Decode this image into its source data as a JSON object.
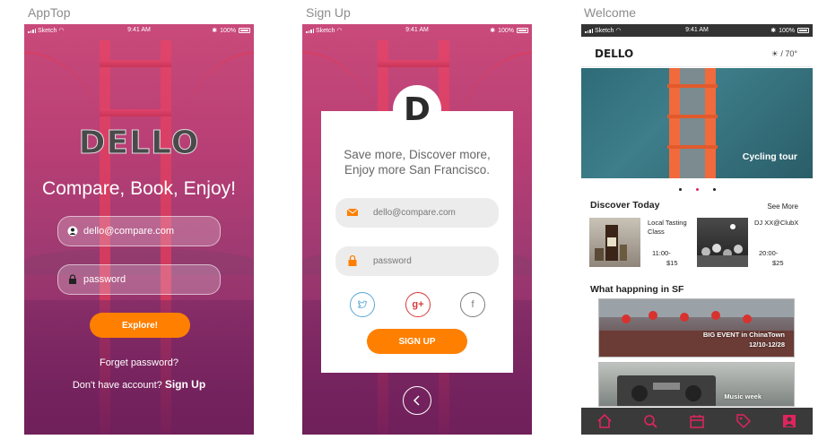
{
  "artboards": [
    {
      "title": "AppTop"
    },
    {
      "title": "Sign Up"
    },
    {
      "title": "Welcome"
    }
  ],
  "statusbar": {
    "carrier": "Sketch",
    "time": "9:41 AM",
    "battery": "100%"
  },
  "screen1": {
    "logo": "DELLO",
    "tagline": "Compare, Book, Enjoy!",
    "email_placeholder": "dello@compare.com",
    "password_placeholder": "password",
    "explore_button": "Explore!",
    "forget_password": "Forget password?",
    "no_account": "Don't have account?",
    "signup_link": "Sign Up"
  },
  "screen2": {
    "logo_letter": "D",
    "title_line1": "Save more, Discover more,",
    "title_line2": "Enjoy more San Francisco.",
    "email_placeholder": "dello@compare.com",
    "password_placeholder": "password",
    "social": {
      "twitter": "twitter-icon",
      "google": "g+",
      "facebook": "f"
    },
    "signup_button": "SIGN UP"
  },
  "screen3": {
    "logo": "DELLO",
    "weather": "/ 70°",
    "hero_caption": "Cycling tour",
    "discover_title": "Discover Today",
    "see_more": "See More",
    "events": [
      {
        "title": "Local Tasting Class",
        "time": "11:00-",
        "price": "$15"
      },
      {
        "title": "DJ XX@ClubX",
        "time": "20:00-",
        "price": "$25"
      }
    ],
    "happening_title": "What happning in SF",
    "banners": [
      {
        "line1": "BIG EVENT in ChinaTown",
        "line2": "12/10-12/28"
      },
      {
        "line1": "Music week",
        "line2": ""
      }
    ],
    "accent_color": "#e0245e"
  },
  "colors": {
    "orange": "#ff7f00",
    "magenta": "#b83f75",
    "tab_icon": "#e0245e"
  }
}
